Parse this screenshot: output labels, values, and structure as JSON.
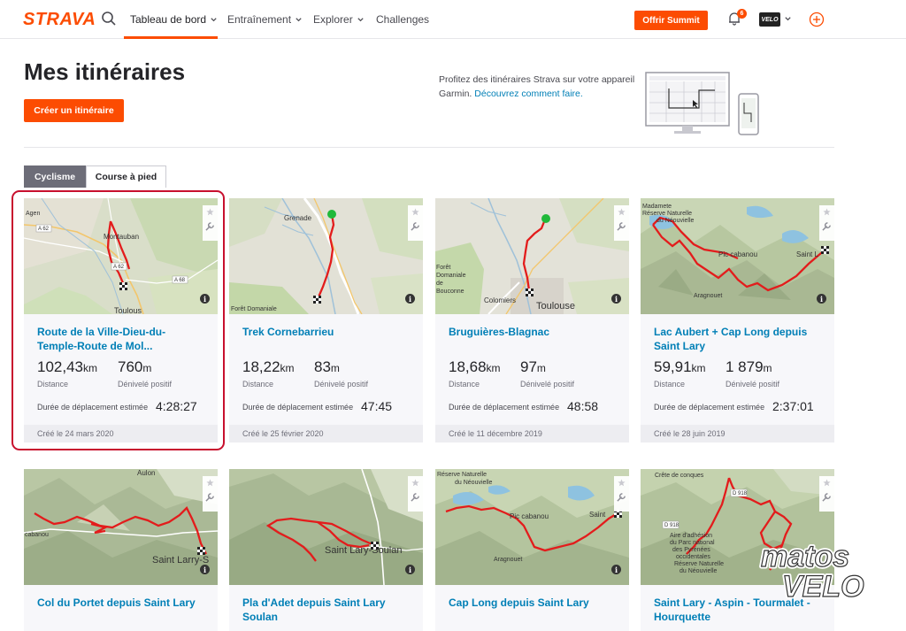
{
  "nav": {
    "logo": "STRAVA",
    "items": [
      {
        "label": "Tableau de bord",
        "active": true
      },
      {
        "label": "Entraînement"
      },
      {
        "label": "Explorer"
      },
      {
        "label": "Challenges"
      }
    ],
    "summit_button": "Offrir Summit",
    "notification_count": "6",
    "avatar_text": "VELO"
  },
  "header": {
    "title": "Mes itinéraires",
    "create_button": "Créer un itinéraire",
    "promo_text": "Profitez des itinéraires Strava sur votre appareil Garmin.",
    "promo_link": "Découvrez comment faire."
  },
  "tabs": [
    {
      "label": "Cyclisme",
      "active": true
    },
    {
      "label": "Course à pied",
      "active": false
    }
  ],
  "labels": {
    "distance": "Distance",
    "elevation": "Dénivelé positif",
    "duration": "Durée de déplacement estimée"
  },
  "routes": [
    {
      "title": "Route de la Ville-Dieu-du-Temple-Route de Mol...",
      "distance": "102,43",
      "distance_unit": "km",
      "elevation": "760",
      "elevation_unit": "m",
      "duration": "4:28:27",
      "created": "Créé le 24 mars 2020",
      "map_labels": [
        "Agen",
        "A 62",
        "Montauban",
        "A 62",
        "A 68",
        "Toulous"
      ]
    },
    {
      "title": "Trek Cornebarrieu",
      "distance": "18,22",
      "distance_unit": "km",
      "elevation": "83",
      "elevation_unit": "m",
      "duration": "47:45",
      "created": "Créé le 25 février 2020",
      "map_labels": [
        "Grenade",
        "Forêt Domaniale"
      ]
    },
    {
      "title": "Bruguières-Blagnac",
      "distance": "18,68",
      "distance_unit": "km",
      "elevation": "97",
      "elevation_unit": "m",
      "duration": "48:58",
      "created": "Créé le 11 décembre 2019",
      "map_labels": [
        "Forêt",
        "Domaniale",
        "de",
        "Bouconne",
        "Colomiers",
        "Toulouse"
      ]
    },
    {
      "title": "Lac Aubert + Cap Long depuis Saint Lary",
      "distance": "59,91",
      "distance_unit": "km",
      "elevation": "1 879",
      "elevation_unit": "m",
      "duration": "2:37:01",
      "created": "Créé le 28 juin 2019",
      "map_labels": [
        "Madamete",
        "Réserve Naturelle",
        "du Néouvielle",
        "Pic cabanou",
        "Saint L",
        "Aragnouet"
      ]
    },
    {
      "title": "Col du Portet depuis Saint Lary",
      "map_labels": [
        "Aulon",
        "cabanou",
        "Saint Larry-S"
      ]
    },
    {
      "title": "Pla d'Adet depuis Saint Lary Soulan",
      "map_labels": [
        "Saint Lary-Soulan"
      ]
    },
    {
      "title": "Cap Long depuis Saint Lary",
      "map_labels": [
        "Réserve Naturelle",
        "du Néouvielle",
        "Pic cabanou",
        "Saint",
        "Aragnouet"
      ]
    },
    {
      "title": "Saint Lary - Aspin - Tourmalet - Hourquette",
      "map_labels": [
        "D 918",
        "Crête de conques",
        "D 918",
        "Aire d'adhésion",
        "du Parc national",
        "des Pyrénées",
        "occidentales",
        "Réserve Naturelle",
        "du Néouvielle"
      ]
    }
  ],
  "watermark": "matos VELO",
  "colors": {
    "brand": "#fc4c02",
    "link": "#007fb6",
    "route": "#e31c1c",
    "highlight": "#c8102e"
  }
}
